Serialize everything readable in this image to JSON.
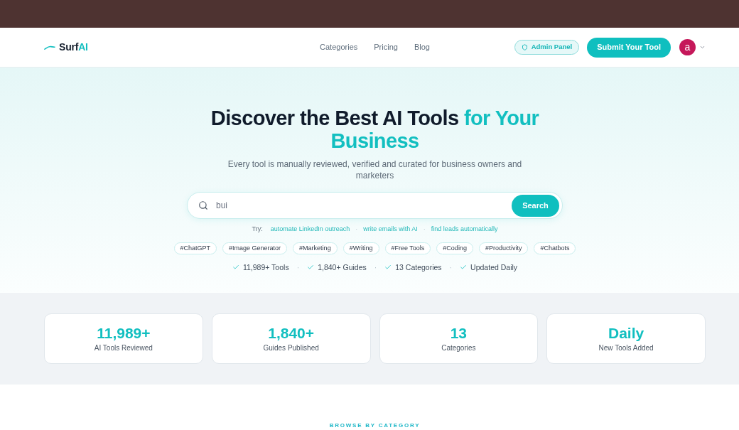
{
  "nav": {
    "logo": {
      "name": "Surf",
      "accent": "AI"
    },
    "links": [
      {
        "label": "Categories"
      },
      {
        "label": "Pricing"
      },
      {
        "label": "Blog"
      }
    ],
    "admin_button": "Admin Panel",
    "submit_button": "Submit Your Tool",
    "avatar": "a"
  },
  "hero": {
    "headline": {
      "lead": "Discover the Best AI Tools",
      "accent": "for Your Business"
    },
    "subtitle": "Every tool is manually reviewed, verified and curated for business owners and marketers",
    "search": {
      "value": "bui",
      "button": "Search"
    },
    "try": {
      "label": "Try:",
      "separator": "·",
      "suggestions": [
        "automate LinkedIn outreach",
        "write emails with AI",
        "find leads automatically"
      ]
    },
    "tags": [
      "#ChatGPT",
      "#Image Generator",
      "#Marketing",
      "#Writing",
      "#Free Tools",
      "#Coding",
      "#Productivity",
      "#Chatbots"
    ],
    "highlights": {
      "separator": "·",
      "items": [
        "11,989+ Tools",
        "1,840+ Guides",
        "13 Categories",
        "Updated Daily"
      ]
    }
  },
  "stats": [
    {
      "value": "11,989+",
      "label": "AI Tools Reviewed"
    },
    {
      "value": "1,840+",
      "label": "Guides Published"
    },
    {
      "value": "13",
      "label": "Categories"
    },
    {
      "value": "Daily",
      "label": "New Tools Added"
    }
  ],
  "browse": {
    "eyebrow": "BROWSE BY CATEGORY"
  }
}
